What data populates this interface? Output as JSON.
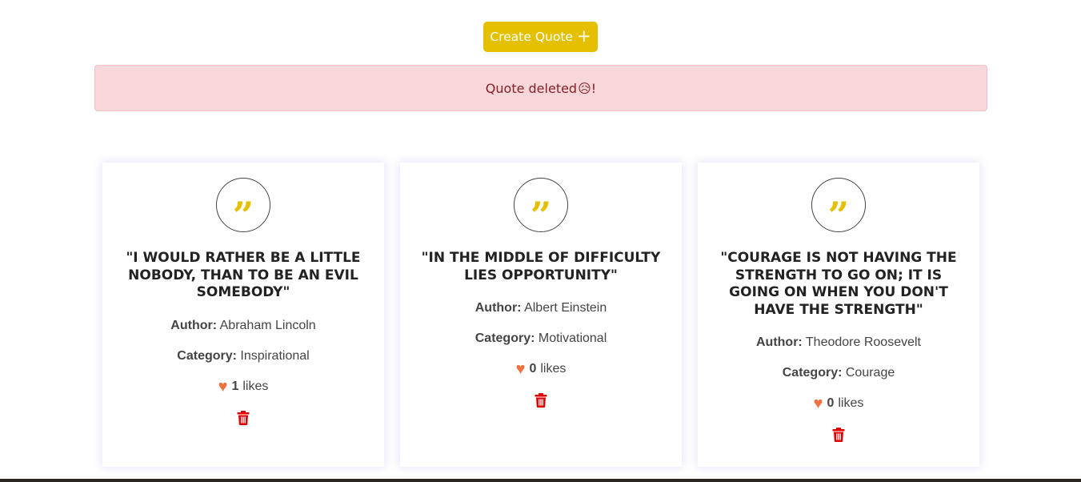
{
  "header": {
    "create_label": "Create Quote",
    "create_icon": "plus-icon"
  },
  "alert": {
    "message": "Quote deleted",
    "emoji": "😥",
    "suffix": "!",
    "bg_color": "#f8d7da",
    "text_color": "#842029"
  },
  "colors": {
    "accent": "#e5c000",
    "heart": "#f07040",
    "delete": "#e00000"
  },
  "labels": {
    "author": "Author:",
    "category": "Category:",
    "likes": "likes"
  },
  "quotes": [
    {
      "text": "\"I would rather be a little nobody, than to be an evil somebody\"",
      "author": "Abraham Lincoln",
      "category": "Inspirational",
      "likes": "1"
    },
    {
      "text": "\"In the middle of difficulty lies opportunity\"",
      "author": "Albert Einstein",
      "category": "Motivational",
      "likes": "0"
    },
    {
      "text": "\"Courage is not having the strength to go on; it is going on when you don't have the strength\"",
      "author": "Theodore Roosevelt",
      "category": "Courage",
      "likes": "0"
    }
  ]
}
